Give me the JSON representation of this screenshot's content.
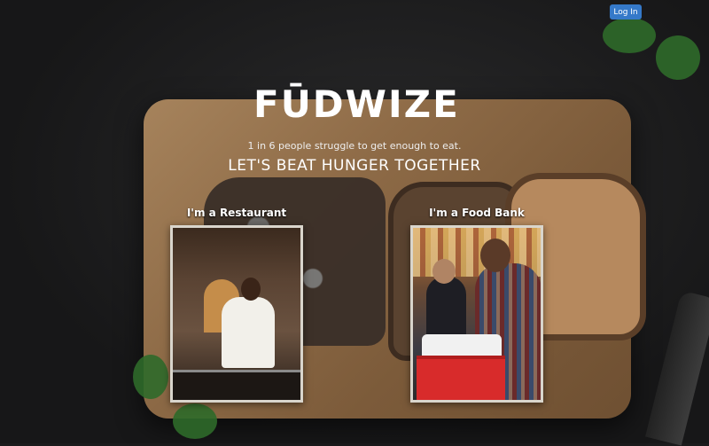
{
  "header": {
    "login_label": "Log In"
  },
  "hero": {
    "brand": "FŪDWIZE",
    "tagline": "1 in 6 people struggle to get enough to eat.",
    "headline": "LET'S BEAT HUNGER TOGETHER"
  },
  "options": [
    {
      "label": "I'm a Restaurant"
    },
    {
      "label": "I'm a Food Bank"
    }
  ],
  "colors": {
    "login_button": "#3579c9",
    "background": "#1b1b1c",
    "board": "#8e6b47"
  }
}
